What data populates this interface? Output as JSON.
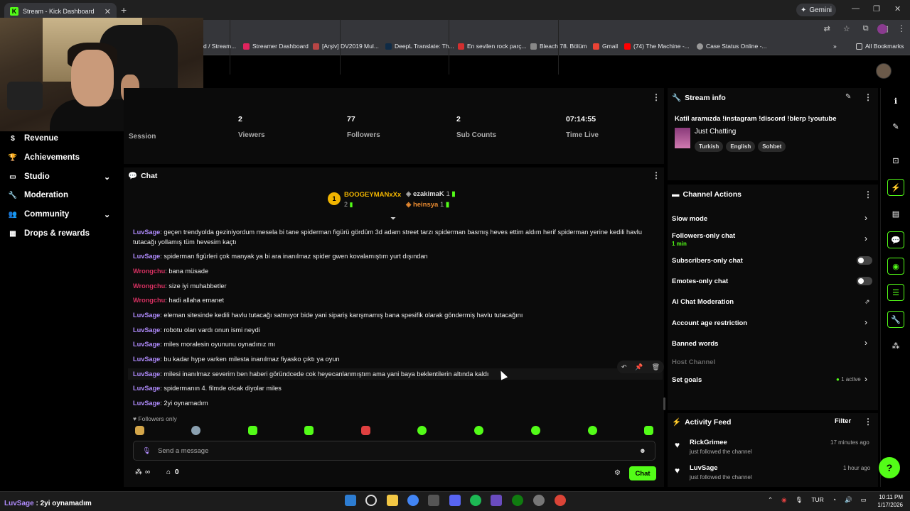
{
  "browser": {
    "tab_title": "Stream - Kick Dashboard",
    "gemini_label": "Gemini",
    "bookmarks": [
      "d / Stream...",
      "Streamer Dashboard",
      "[Arşiv] DV2019 Mul...",
      "DeepL Translate: Th...",
      "En sevilen rock parç...",
      "Bleach 78. Bölüm",
      "Gmail",
      "(74) The Machine -...",
      "Case Status Online -..."
    ],
    "all_bookmarks": "All Bookmarks"
  },
  "sidebar": {
    "items": [
      {
        "label": "Revenue",
        "icon": "dollar-icon"
      },
      {
        "label": "Achievements",
        "icon": "trophy-icon"
      },
      {
        "label": "Studio",
        "icon": "monitor-icon",
        "expandable": true
      },
      {
        "label": "Moderation",
        "icon": "wrench-icon"
      },
      {
        "label": "Community",
        "icon": "people-icon",
        "expandable": true
      },
      {
        "label": "Drops & rewards",
        "icon": "gift-icon"
      }
    ]
  },
  "stats": {
    "session_label": "Session",
    "items": [
      {
        "value": "2",
        "label": "Viewers"
      },
      {
        "value": "77",
        "label": "Followers"
      },
      {
        "value": "2",
        "label": "Sub Counts"
      },
      {
        "value": "07:14:55",
        "label": "Time Live"
      }
    ]
  },
  "chat": {
    "title": "Chat",
    "leaderboard": {
      "first_name": "BOOGEYMANxXx",
      "first_count": "2",
      "second_name": "ezakimaK",
      "second_count": "1",
      "third_name": "heinsya",
      "third_count": "1",
      "rank_badge": "1"
    },
    "messages": [
      {
        "user": "LuvSage",
        "color": "purple",
        "text": ": geçen trendyolda geziniyordum mesela bi tane spiderman figürü gördüm 3d adam street tarzı spiderman basmış heves ettim aldım herif spiderman yerine kedili havlu tutacağı yollamış tüm hevesim kaçtı"
      },
      {
        "user": "LuvSage",
        "color": "purple",
        "text": ": spiderman figürleri çok manyak ya bi ara inanılmaz spider gwen kovalamıştım yurt dışından"
      },
      {
        "user": "Wrongchu",
        "color": "red",
        "text": ": bana müsade"
      },
      {
        "user": "Wrongchu",
        "color": "red",
        "text": ": size iyi muhabbetler"
      },
      {
        "user": "Wrongchu",
        "color": "red",
        "text": ": hadi allaha emanet"
      },
      {
        "user": "LuvSage",
        "color": "purple",
        "text": ": eleman sitesinde kedili havlu tutacağı satmıyor bide yani sipariş karışmamış bana spesifik olarak göndermiş havlu tutacağını"
      },
      {
        "user": "LuvSage",
        "color": "purple",
        "text": ": robotu olan vardı onun ismi neydi"
      },
      {
        "user": "LuvSage",
        "color": "purple",
        "text": ": miles moralesin oyununu oynadınız mı"
      },
      {
        "user": "LuvSage",
        "color": "purple",
        "text": ": bu kadar hype varken milesta inanılmaz fiyasko çıktı ya oyun"
      },
      {
        "user": "LuvSage",
        "color": "purple",
        "text": ": milesi inanılmaz severim ben haberi göründcede cok heyecanlanmıştım ama yani baya beklentilerin altında kaldı"
      },
      {
        "user": "LuvSage",
        "color": "purple",
        "text": ": spidermanın 4. filmde olcak diyolar miles"
      },
      {
        "user": "LuvSage",
        "color": "purple",
        "text": ": 2yi oynamadım"
      }
    ],
    "followers_only": "Followers only",
    "input_placeholder": "Send a message",
    "points_value": "0",
    "infinity": "∞",
    "send_label": "Chat"
  },
  "stream_info": {
    "title": "Stream info",
    "stream_title": "Katil aramızda !instagram !discord !blerp !youtube",
    "category": "Just Chatting",
    "tags": [
      "Turkish",
      "English",
      "Sohbet"
    ]
  },
  "channel_actions": {
    "title": "Channel Actions",
    "slow_mode": "Slow mode",
    "followers_only": "Followers-only chat",
    "followers_only_sub": "1 min",
    "subscribers_only": "Subscribers-only chat",
    "emotes_only": "Emotes-only chat",
    "ai_moderation": "AI Chat Moderation",
    "account_age": "Account age restriction",
    "banned_words": "Banned words",
    "host_channel": "Host Channel",
    "set_goals": "Set goals",
    "goals_status": "1 active"
  },
  "activity_feed": {
    "title": "Activity Feed",
    "filter_label": "Filter",
    "items": [
      {
        "user": "RickGrimee",
        "action": "just followed the channel",
        "time": "17 minutes ago"
      },
      {
        "user": "LuvSage",
        "action": "just followed the channel",
        "time": "1 hour ago"
      }
    ]
  },
  "overlay_message": {
    "user": "LuvSage",
    "text": " : 2yi oynamadım"
  },
  "taskbar": {
    "lang": "TUR",
    "time": "10:11 PM",
    "date": "1/17/2026"
  },
  "colors": {
    "kick_green": "#53fc18",
    "purple_user": "#b18cff",
    "red_user": "#d43060"
  }
}
